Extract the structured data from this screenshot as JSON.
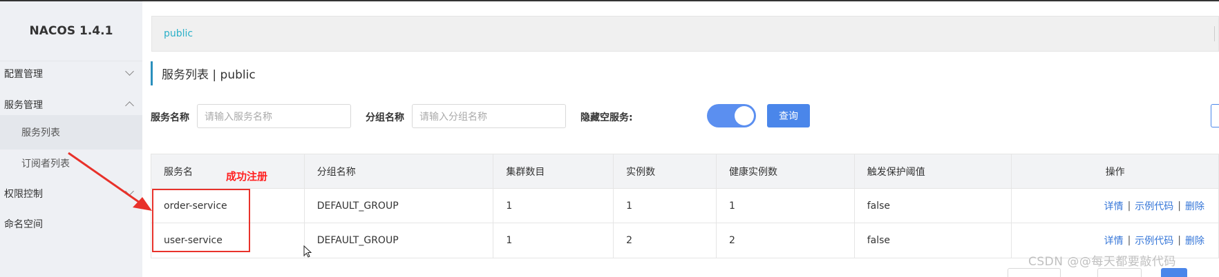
{
  "app": {
    "brand": "NACOS 1.4.1"
  },
  "sidebar": {
    "items": [
      {
        "label": "配置管理"
      },
      {
        "label": "服务管理"
      },
      {
        "label": "服务列表"
      },
      {
        "label": "订阅者列表"
      },
      {
        "label": "权限控制"
      },
      {
        "label": "命名空间"
      }
    ]
  },
  "namespace": {
    "current": "public"
  },
  "page": {
    "title": "服务列表 | public"
  },
  "search": {
    "service_name_label": "服务名称",
    "service_name_placeholder": "请输入服务名称",
    "group_name_label": "分组名称",
    "group_name_placeholder": "请输入分组名称",
    "hide_empty_label": "隐藏空服务:",
    "hide_empty_on": true,
    "query_label": "查询"
  },
  "table": {
    "headers": [
      "服务名",
      "分组名称",
      "集群数目",
      "实例数",
      "健康实例数",
      "触发保护阈值",
      "操作"
    ],
    "rows": [
      {
        "service": "order-service",
        "group": "DEFAULT_GROUP",
        "clusters": "1",
        "instances": "1",
        "healthy": "1",
        "threshold": "false"
      },
      {
        "service": "user-service",
        "group": "DEFAULT_GROUP",
        "clusters": "1",
        "instances": "2",
        "healthy": "2",
        "threshold": "false"
      }
    ],
    "actions": {
      "detail": "详情",
      "sample": "示例代码",
      "delete": "删除",
      "separator": "|"
    }
  },
  "annotation": {
    "label": "成功注册",
    "color": "#e8312a"
  },
  "watermark": "CSDN @@每天都要敲代码",
  "colors": {
    "primary": "#4a86ea",
    "link": "#3576d8",
    "namespace_link": "#2ab0c8",
    "sidebar_bg": "#eef0f4"
  }
}
